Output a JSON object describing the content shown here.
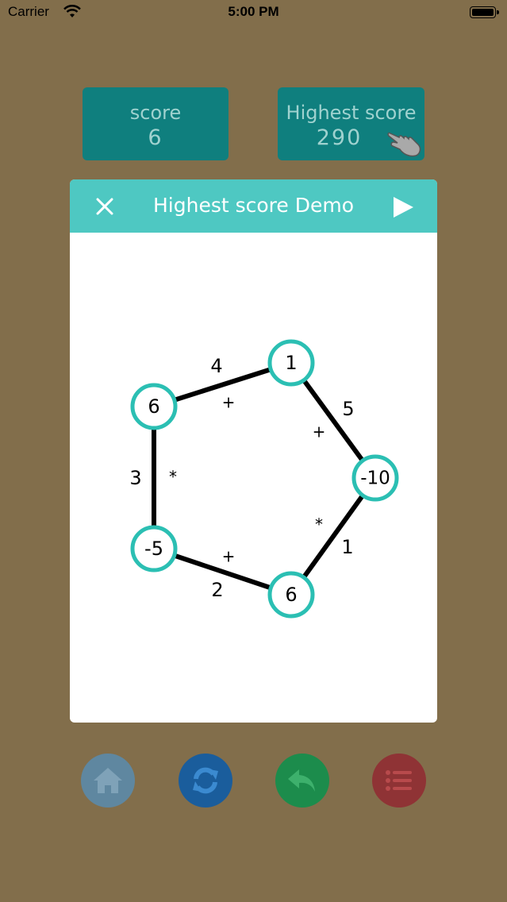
{
  "status_bar": {
    "carrier": "Carrier",
    "time": "5:00 PM"
  },
  "score": {
    "label": "score",
    "value": "6"
  },
  "highest": {
    "label": "Highest score",
    "value": "290"
  },
  "dialog": {
    "title": "Highest score Demo"
  },
  "puzzle": {
    "nodes": [
      {
        "id": "top",
        "value": "1"
      },
      {
        "id": "right",
        "value": "-10"
      },
      {
        "id": "bottom",
        "value": "6"
      },
      {
        "id": "left-bottom",
        "value": "-5"
      },
      {
        "id": "left-top",
        "value": "6"
      }
    ],
    "edges": [
      {
        "from": "left-top",
        "to": "top",
        "order": "4",
        "op": "+"
      },
      {
        "from": "top",
        "to": "right",
        "order": "5",
        "op": "+"
      },
      {
        "from": "right",
        "to": "bottom",
        "order": "1",
        "op": "*"
      },
      {
        "from": "bottom",
        "to": "left-bottom",
        "order": "2",
        "op": "+"
      },
      {
        "from": "left-bottom",
        "to": "left-top",
        "order": "3",
        "op": "*"
      }
    ]
  },
  "colors": {
    "background": "#826e4b",
    "score_box": "#0f7f7e",
    "header": "#4ec8c2",
    "node_ring": "#2bbfb3",
    "home": "#5f87a0",
    "refresh": "#1a5d9c",
    "undo": "#1c8c4c",
    "menu": "#8f3335"
  },
  "icons": [
    "wifi-icon",
    "battery-icon",
    "hand-pointer-icon",
    "close-icon",
    "play-icon",
    "home-icon",
    "refresh-icon",
    "undo-icon",
    "list-icon"
  ]
}
